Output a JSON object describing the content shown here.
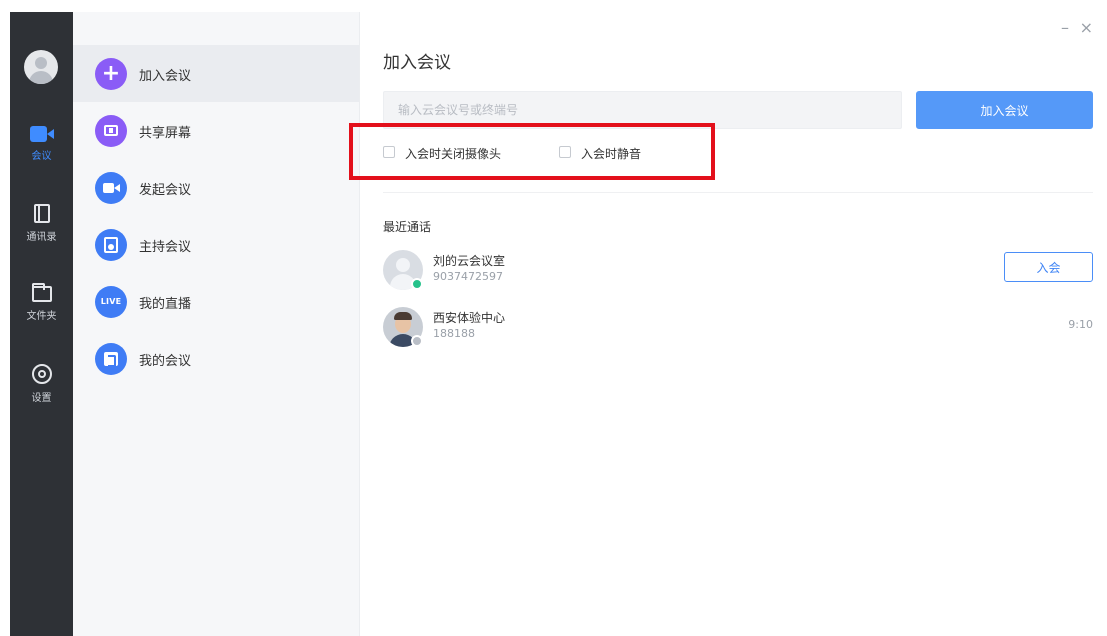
{
  "rail": {
    "items": [
      {
        "label": "会议",
        "icon": "video-camera-icon",
        "active": true
      },
      {
        "label": "通讯录",
        "icon": "contacts-book-icon",
        "active": false
      },
      {
        "label": "文件夹",
        "icon": "folder-icon",
        "active": false
      },
      {
        "label": "设置",
        "icon": "gear-icon",
        "active": false
      }
    ]
  },
  "menu": {
    "items": [
      {
        "label": "加入会议",
        "icon": "plus-icon",
        "active": true
      },
      {
        "label": "共享屏幕",
        "icon": "share-screen-icon",
        "active": false
      },
      {
        "label": "发起会议",
        "icon": "video-camera-icon",
        "active": false
      },
      {
        "label": "主持会议",
        "icon": "host-icon",
        "active": false
      },
      {
        "label": "我的直播",
        "icon": "live-icon",
        "badge_text": "LIVE",
        "active": false
      },
      {
        "label": "我的会议",
        "icon": "calendar-icon",
        "active": false
      }
    ]
  },
  "window": {
    "minimize": "–",
    "close": "×"
  },
  "join": {
    "title": "加入会议",
    "input_placeholder": "输入云会议号或终端号",
    "input_value": "",
    "button_label": "加入会议",
    "options": [
      {
        "label": "入会时关闭摄像头",
        "checked": false
      },
      {
        "label": "入会时静音",
        "checked": false
      }
    ]
  },
  "recent": {
    "title": "最近通话",
    "calls": [
      {
        "name": "刘的云会议室",
        "number": "9037472597",
        "action_label": "入会",
        "time": ""
      },
      {
        "name": "西安体验中心",
        "number": "188188",
        "action_label": "",
        "time": "9:10"
      }
    ]
  },
  "colors": {
    "rail_bg": "#2e3136",
    "accent": "#3f8cff",
    "primary_button": "#5599f8",
    "highlight_box": "#e3101b"
  }
}
